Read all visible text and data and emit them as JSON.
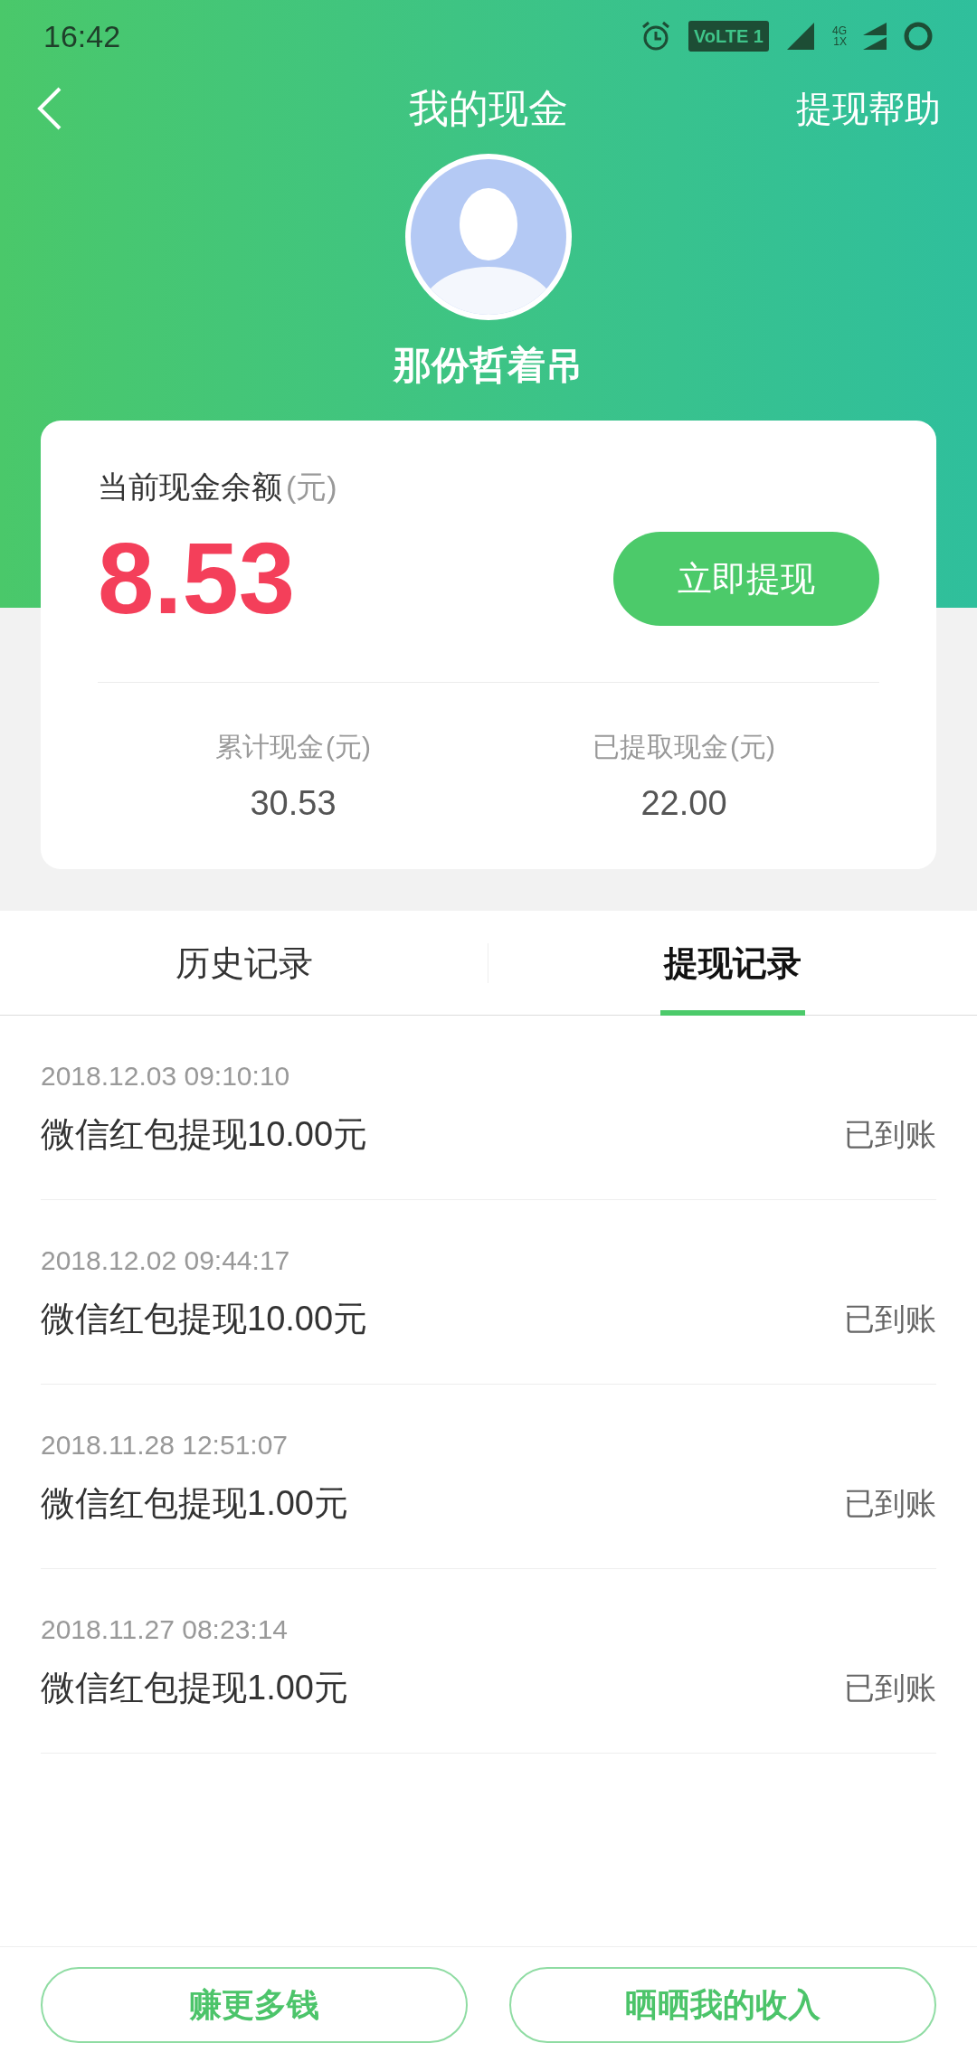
{
  "status_bar": {
    "time": "16:42",
    "volte": "VoLTE 1",
    "network_top": "4G",
    "network_bottom": "1X"
  },
  "header": {
    "title": "我的现金",
    "action": "提现帮助"
  },
  "profile": {
    "name": "那份哲着吊"
  },
  "balance_card": {
    "label": "当前现金余额",
    "unit": "(元)",
    "amount": "8.53",
    "button": "立即提现",
    "stats": [
      {
        "label": "累计现金",
        "unit": "(元)",
        "value": "30.53"
      },
      {
        "label": "已提取现金",
        "unit": "(元)",
        "value": "22.00"
      }
    ]
  },
  "tabs": [
    {
      "label": "历史记录",
      "selected": false
    },
    {
      "label": "提现记录",
      "selected": true
    }
  ],
  "records": [
    {
      "time": "2018.12.03 09:10:10",
      "title": "微信红包提现10.00元",
      "status": "已到账"
    },
    {
      "time": "2018.12.02 09:44:17",
      "title": "微信红包提现10.00元",
      "status": "已到账"
    },
    {
      "time": "2018.11.28 12:51:07",
      "title": "微信红包提现1.00元",
      "status": "已到账"
    },
    {
      "time": "2018.11.27 08:23:14",
      "title": "微信红包提现1.00元",
      "status": "已到账"
    }
  ],
  "bottom_buttons": [
    "赚更多钱",
    "晒晒我的收入"
  ]
}
